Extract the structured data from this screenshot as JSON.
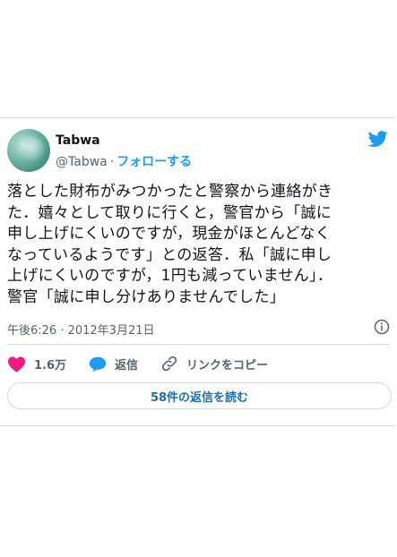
{
  "tweet": {
    "author_name": "Tabwa",
    "handle": "@Tabwa",
    "separator": "·",
    "follow_label": "フォローする",
    "text_lines": [
      "落とした財布がみつかったと警察から連絡がき",
      "た．嬉々として取りに行くと，警官から「誠に",
      "申し上げにくいのですが，現金がほとんどなく",
      "なっているようです」との返答．私「誠に申し",
      "上げにくいのですが，1円も減っていません」．",
      "警官「誠に申し分けありませんでした」"
    ],
    "timestamp": "午後6:26 · 2012年3月21日"
  },
  "actions": {
    "like_count": "1.6万",
    "reply_label": "返信",
    "copy_link_label": "リンクをコピー"
  },
  "replies_button": {
    "label": "58件の返信を読む"
  },
  "colors": {
    "brand": "#1d9bf0",
    "like": "#f91880",
    "reply_icon": "#1d9bf0",
    "border": "#cfd9de",
    "muted": "#536471"
  },
  "icons": [
    "twitter-bird-icon",
    "info-icon",
    "heart-icon",
    "reply-bubble-icon",
    "link-icon"
  ]
}
